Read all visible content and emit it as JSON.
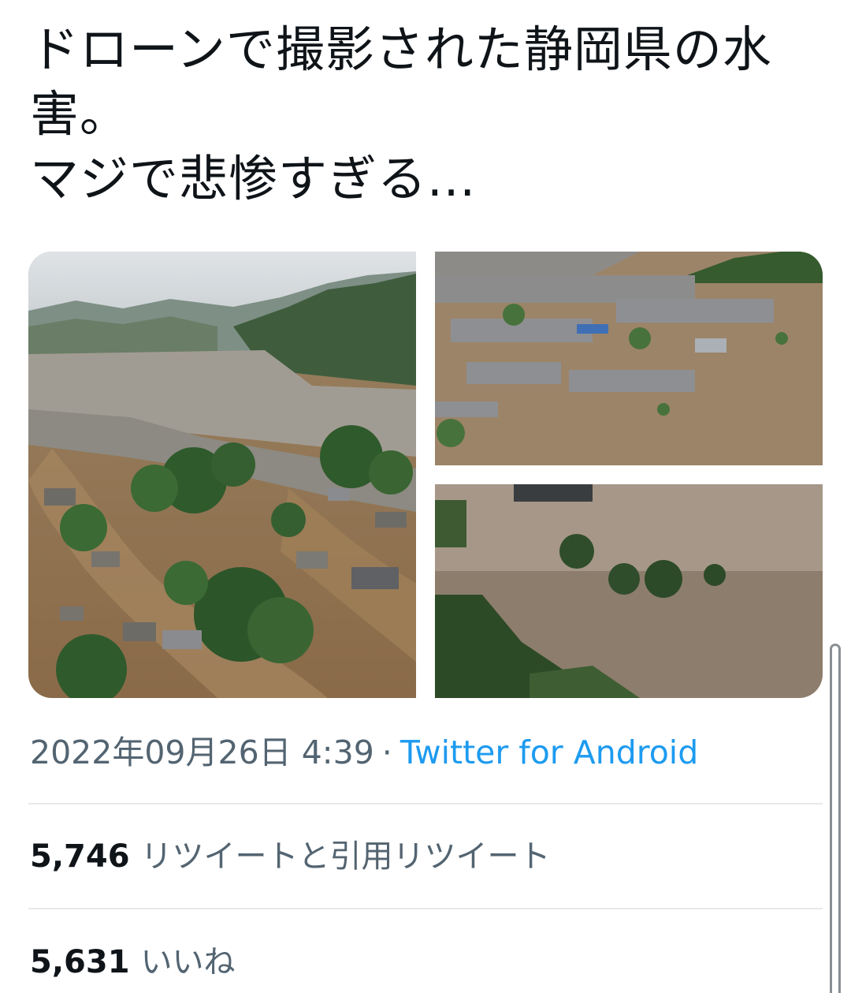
{
  "tweet": {
    "text_lines": [
      "ドローンで撮影された静岡県の水",
      "害。",
      "マジで悲惨すぎる..."
    ],
    "media": [
      {
        "name": "aerial-flooded-town-valley"
      },
      {
        "name": "flooded-neighborhood-rooftops"
      },
      {
        "name": "muddy-floodwater-trees"
      }
    ],
    "timestamp": "2022年09月26日 4:39",
    "separator": "·",
    "source": "Twitter for Android"
  },
  "stats": {
    "retweets_count": "5,746",
    "retweets_label": "リツイートと引用リツイート",
    "likes_count": "5,631",
    "likes_label": "いいね"
  },
  "colors": {
    "text": "#0f1419",
    "secondary": "#536471",
    "link": "#1d9bf0",
    "divider": "#e6e9eb"
  }
}
